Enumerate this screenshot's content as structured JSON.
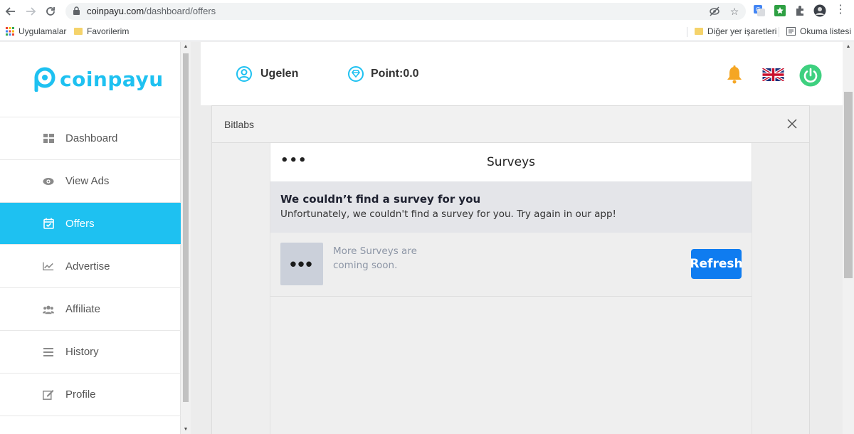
{
  "browser": {
    "url_host": "coinpayu.com",
    "url_path": "/dashboard/offers",
    "bookmarks": {
      "apps": "Uygulamalar",
      "favorites": "Favorilerim",
      "other": "Diğer yer işaretleri",
      "reading_list": "Okuma listesi"
    }
  },
  "sidebar": {
    "logo_text": "coinpayu",
    "brand_color": "#1ec1f1",
    "items": [
      {
        "label": "Dashboard",
        "icon": "grid-icon",
        "active": false
      },
      {
        "label": "View Ads",
        "icon": "eye-icon",
        "active": false
      },
      {
        "label": "Offers",
        "icon": "calendar-check-icon",
        "active": true
      },
      {
        "label": "Advertise",
        "icon": "chart-line-icon",
        "active": false
      },
      {
        "label": "Affiliate",
        "icon": "users-icon",
        "active": false
      },
      {
        "label": "History",
        "icon": "list-icon",
        "active": false
      },
      {
        "label": "Profile",
        "icon": "edit-icon",
        "active": false
      }
    ]
  },
  "header": {
    "username": "Ugelen",
    "points": "Point:0.0"
  },
  "modal": {
    "title": "Bitlabs",
    "frame_title": "Surveys",
    "notice_title": "We couldn’t find a survey for you",
    "notice_text": "Unfortunately, we couldn't find a survey for you. Try again in our app!",
    "row_text_line1": "More Surveys are",
    "row_text_line2": "coming soon.",
    "row_thumb": "•••",
    "refresh_label": "Refresh",
    "menu_dots": "•••"
  }
}
